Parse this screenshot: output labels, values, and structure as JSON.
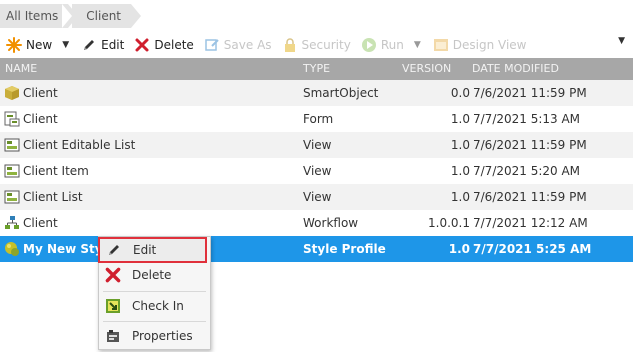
{
  "breadcrumb": {
    "items": [
      "All Items",
      "Client"
    ]
  },
  "toolbar": {
    "new_label": "New",
    "edit_label": "Edit",
    "delete_label": "Delete",
    "save_as_label": "Save As",
    "security_label": "Security",
    "run_label": "Run",
    "design_view_label": "Design View"
  },
  "table": {
    "headers": {
      "name": "NAME",
      "type": "TYPE",
      "version": "VERSION",
      "date_modified": "DATE MODIFIED"
    },
    "rows": [
      {
        "name": "Client",
        "type": "SmartObject",
        "version": "0.0",
        "date": "7/6/2021 11:59 PM",
        "icon": "smartobject-icon"
      },
      {
        "name": "Client",
        "type": "Form",
        "version": "1.0",
        "date": "7/7/2021 5:13 AM",
        "icon": "form-icon"
      },
      {
        "name": "Client Editable List",
        "type": "View",
        "version": "1.0",
        "date": "7/6/2021 11:59 PM",
        "icon": "view-icon"
      },
      {
        "name": "Client Item",
        "type": "View",
        "version": "1.0",
        "date": "7/7/2021 5:20 AM",
        "icon": "view-icon"
      },
      {
        "name": "Client List",
        "type": "View",
        "version": "1.0",
        "date": "7/6/2021 11:59 PM",
        "icon": "view-icon"
      },
      {
        "name": "Client",
        "type": "Workflow",
        "version": "1.0.0.1",
        "date": "7/7/2021 12:12 AM",
        "icon": "workflow-icon"
      },
      {
        "name": "My New Style",
        "type": "Style Profile",
        "version": "1.0",
        "date": "7/7/2021 5:25 AM",
        "icon": "style-profile-icon",
        "selected": true
      }
    ]
  },
  "context_menu": {
    "items": [
      {
        "label": "Edit",
        "icon": "pencil-icon"
      },
      {
        "label": "Delete",
        "icon": "delete-x-icon"
      },
      {
        "label": "Check In",
        "icon": "check-in-icon"
      },
      {
        "label": "Properties",
        "icon": "properties-icon"
      }
    ]
  },
  "colors": {
    "selection": "#1e96e8",
    "header": "#a7a7a7",
    "highlight_border": "#e0303b"
  }
}
